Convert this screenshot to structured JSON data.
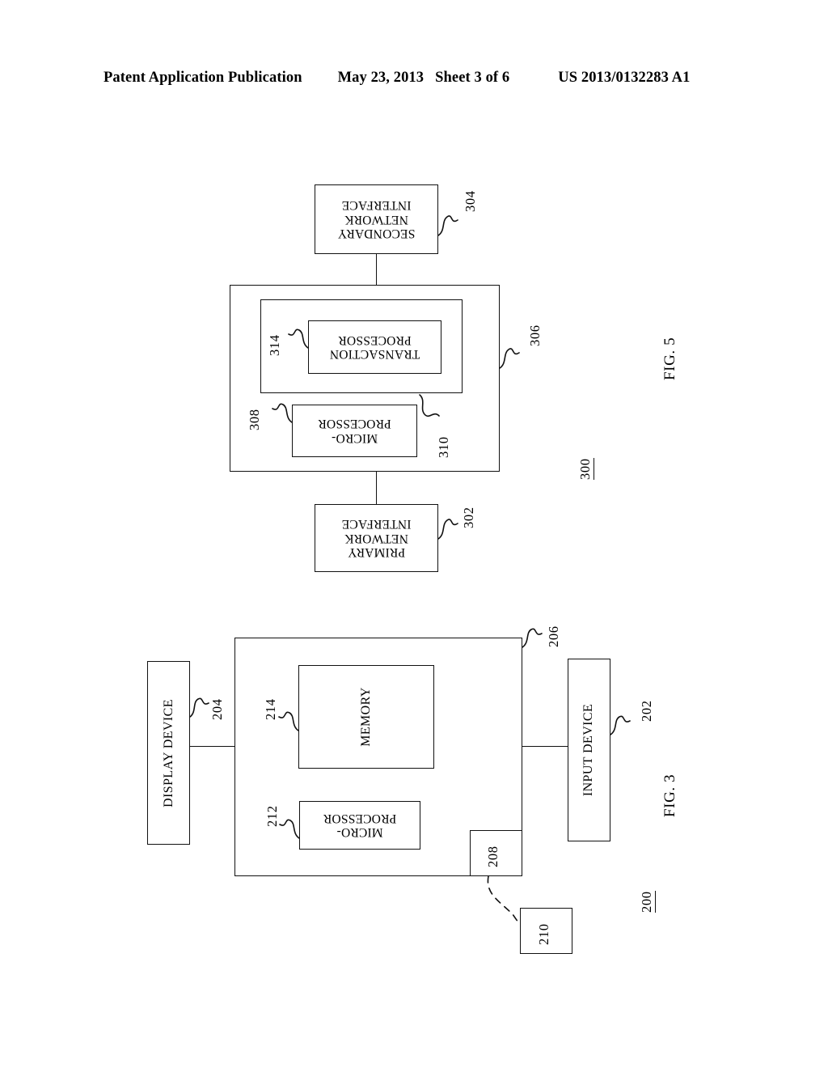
{
  "header": {
    "publication": "Patent Application Publication",
    "date": "May 23, 2013",
    "sheet": "Sheet 3 of 6",
    "patent_number": "US 2013/0132283 A1"
  },
  "figures": [
    {
      "caption": "FIG. 5",
      "assembly_ref": "300",
      "boxes": [
        {
          "ref": "304",
          "label": "SECONDARY\nNETWORK\nINTERFACE"
        },
        {
          "ref": "306",
          "label": ""
        },
        {
          "ref": "310",
          "label": ""
        },
        {
          "ref": "314",
          "label": "TRANSACTION\nPROCESSOR"
        },
        {
          "ref": "308",
          "label": "MICRO-\nPROCESSOR"
        },
        {
          "ref": "302",
          "label": "PRIMARY\nNETWORK\nINTERFACE"
        }
      ]
    },
    {
      "caption": "FIG. 3",
      "assembly_ref": "200",
      "boxes": [
        {
          "ref": "204",
          "label": "DISPLAY DEVICE"
        },
        {
          "ref": "206",
          "label": ""
        },
        {
          "ref": "214",
          "label": "MEMORY"
        },
        {
          "ref": "212",
          "label": "MICRO-\nPROCESSOR"
        },
        {
          "ref": "208",
          "label": ""
        },
        {
          "ref": "210",
          "label": ""
        },
        {
          "ref": "202",
          "label": "INPUT DEVICE"
        }
      ]
    }
  ],
  "fig5": {
    "secondary_network_interface": "SECONDARY\nNETWORK\nINTERFACE",
    "secondary_network_interface_ref": "304",
    "outer_ref": "306",
    "inner_ref": "310",
    "transaction_processor": "TRANSACTION\nPROCESSOR",
    "transaction_processor_ref": "314",
    "microprocessor": "MICRO-\nPROCESSOR",
    "microprocessor_ref": "308",
    "primary_network_interface": "PRIMARY\nNETWORK\nINTERFACE",
    "primary_network_interface_ref": "302",
    "assembly_ref": "300",
    "caption": "FIG. 5"
  },
  "fig3": {
    "display_device": "DISPLAY DEVICE",
    "display_device_ref": "204",
    "outer_ref": "206",
    "memory": "MEMORY",
    "memory_ref": "214",
    "microprocessor": "MICRO-\nPROCESSOR",
    "microprocessor_ref": "212",
    "port_ref": "208",
    "peripheral_ref": "210",
    "input_device": "INPUT DEVICE",
    "input_device_ref": "202",
    "assembly_ref": "200",
    "caption": "FIG. 3"
  },
  "colors": {
    "ink": "#111111",
    "paper": "#ffffff"
  }
}
